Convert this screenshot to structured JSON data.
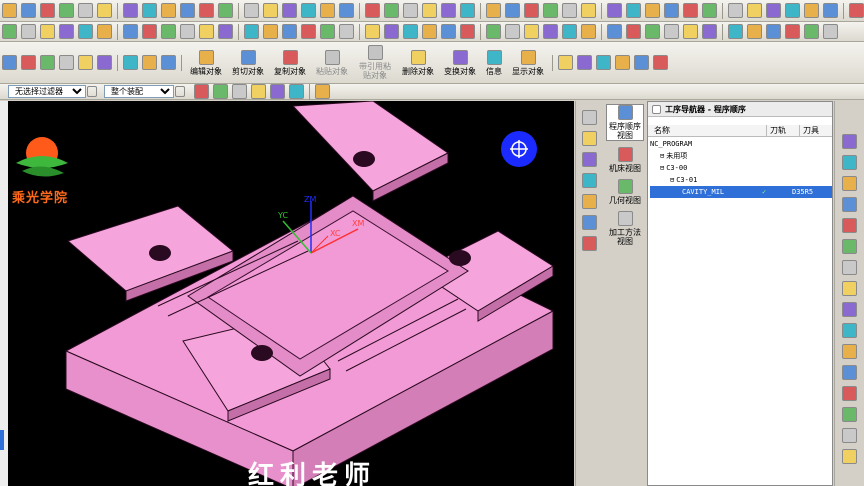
{
  "toolbar_row2": {
    "commands": [
      {
        "label": "编辑对象",
        "enabled": true
      },
      {
        "label": "剪切对象",
        "enabled": true
      },
      {
        "label": "复制对象",
        "enabled": true
      },
      {
        "label": "粘贴对象",
        "enabled": false
      },
      {
        "label": "带引用粘贴对象",
        "enabled": false
      },
      {
        "label": "删除对象",
        "enabled": true
      },
      {
        "label": "变换对象",
        "enabled": true
      },
      {
        "label": "信息",
        "enabled": true
      },
      {
        "label": "显示对象",
        "enabled": true
      }
    ]
  },
  "filter_bar": {
    "selection_filter": "无选择过滤器",
    "scope": "整个装配"
  },
  "viewport": {
    "background": "#000000",
    "part_color": "#f29ad6",
    "logo_text": "乘光学院",
    "watermark_text": "红利老师",
    "axes": {
      "xc": "XC",
      "xm": "XM",
      "yc": "YC",
      "zm": "ZM"
    }
  },
  "resource_tabs": [
    {
      "label": "程序顺序视图",
      "active": true
    },
    {
      "label": "机床视图",
      "active": false
    },
    {
      "label": "几何视图",
      "active": false
    },
    {
      "label": "加工方法视图",
      "active": false
    }
  ],
  "navigator": {
    "title": "工序导航器 - 程序顺序",
    "columns": [
      "名称",
      "刀轨",
      "刀具"
    ],
    "rows": [
      {
        "name": "NC_PROGRAM",
        "indent": 0,
        "toolpath": "",
        "tool": ""
      },
      {
        "name": "未用项",
        "indent": 1,
        "toolpath": "",
        "tool": ""
      },
      {
        "name": "C3-00",
        "indent": 1,
        "toolpath": "",
        "tool": ""
      },
      {
        "name": "C3-01",
        "indent": 2,
        "toolpath": "",
        "tool": ""
      },
      {
        "name": "CAVITY_MIL",
        "indent": 3,
        "toolpath": "✓",
        "tool": "D35R5",
        "selected": true
      }
    ]
  }
}
